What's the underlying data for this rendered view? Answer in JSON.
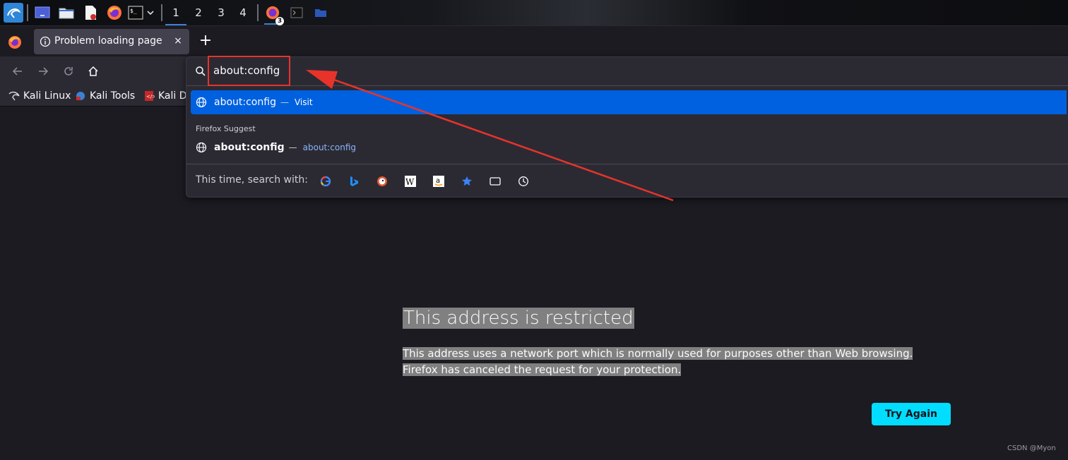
{
  "taskbar": {
    "icons": [
      "kali-menu-icon",
      "desktop-icon",
      "file-manager-icon",
      "text-editor-icon",
      "firefox-icon",
      "terminal-icon",
      "chevron-down-icon"
    ],
    "workspaces": [
      "1",
      "2",
      "3",
      "4"
    ],
    "active_workspace": "1",
    "firefox_badge": "3"
  },
  "browser": {
    "tab_title": "Problem loading page",
    "tab_close": "×",
    "new_tab": "+"
  },
  "bookmarks": [
    {
      "label": "Kali Linux",
      "icon": "kali-dragon-icon"
    },
    {
      "label": "Kali Tools",
      "icon": "kali-tools-icon"
    },
    {
      "label": "Kali Do",
      "icon": "kali-docs-icon"
    }
  ],
  "urlbar": {
    "value": "about:config",
    "suggestions": [
      {
        "title": "about:config",
        "separator": "—",
        "action": "Visit"
      }
    ],
    "section_label": "Firefox Suggest",
    "suggest": [
      {
        "title": "about:config",
        "separator": "—",
        "action": "about:config"
      }
    ],
    "search_with_label": "This time, search with:",
    "engines": [
      "google-icon",
      "bing-icon",
      "duckduckgo-icon",
      "wikipedia-icon",
      "amazon-icon",
      "bookmarks-star-icon",
      "tabs-icon",
      "history-icon"
    ]
  },
  "error_page": {
    "title": "This address is restricted",
    "line1": "This address uses a network port which is normally used for purposes other than Web browsing.",
    "line2": "Firefox has canceled the request for your protection.",
    "button": "Try Again"
  },
  "watermark": "CSDN @Myon⁦",
  "colors": {
    "accent": "#0061e0",
    "button": "#00ddff",
    "annotation": "#e8332b"
  }
}
